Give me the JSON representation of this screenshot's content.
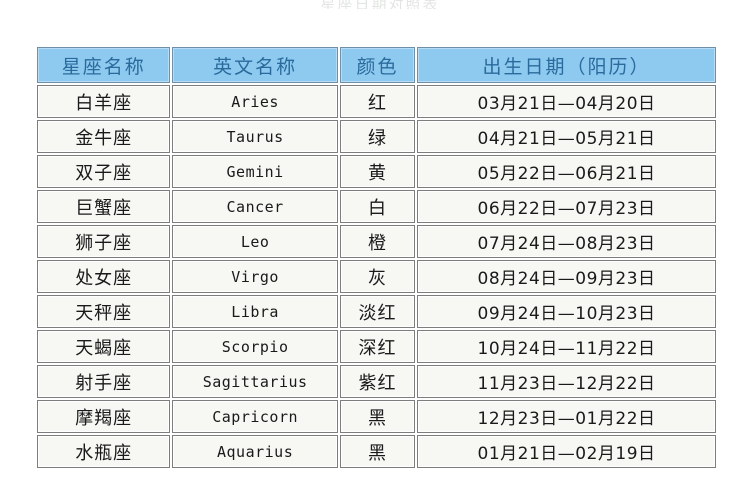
{
  "page": {
    "clipped_title_remnant": "星座日期对照表"
  },
  "table": {
    "headers": {
      "name": "星座名称",
      "english": "英文名称",
      "color": "颜色",
      "birthdate": "出生日期（阳历）"
    },
    "rows": [
      {
        "name": "白羊座",
        "english": "Aries",
        "color": "红",
        "birthdate": "03月21日—04月20日"
      },
      {
        "name": "金牛座",
        "english": "Taurus",
        "color": "绿",
        "birthdate": "04月21日—05月21日"
      },
      {
        "name": "双子座",
        "english": "Gemini",
        "color": "黄",
        "birthdate": "05月22日—06月21日"
      },
      {
        "name": "巨蟹座",
        "english": "Cancer",
        "color": "白",
        "birthdate": "06月22日—07月23日"
      },
      {
        "name": "狮子座",
        "english": "Leo",
        "color": "橙",
        "birthdate": "07月24日—08月23日"
      },
      {
        "name": "处女座",
        "english": "Virgo",
        "color": "灰",
        "birthdate": "08月24日—09月23日"
      },
      {
        "name": "天秤座",
        "english": "Libra",
        "color": "淡红",
        "birthdate": "09月24日—10月23日"
      },
      {
        "name": "天蝎座",
        "english": "Scorpio",
        "color": "深红",
        "birthdate": "10月24日—11月22日"
      },
      {
        "name": "射手座",
        "english": "Sagittarius",
        "color": "紫红",
        "birthdate": "11月23日—12月22日"
      },
      {
        "name": "摩羯座",
        "english": "Capricorn",
        "color": "黑",
        "birthdate": "12月23日—01月22日"
      },
      {
        "name": "水瓶座",
        "english": "Aquarius",
        "color": "黑",
        "birthdate": "01月21日—02月19日"
      }
    ]
  },
  "colors": {
    "header_background": "#8ec9f0",
    "header_text": "#2a6b9c",
    "cell_background": "#f7f7f4",
    "cell_border": "#7d7d7d",
    "page_background": "#ffffff"
  }
}
